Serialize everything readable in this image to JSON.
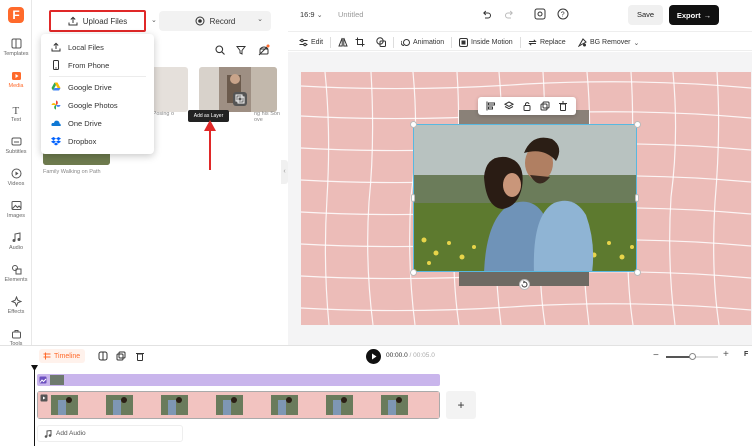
{
  "rail": {
    "items": [
      {
        "label": "Templates",
        "icon": "templates-icon"
      },
      {
        "label": "Media",
        "icon": "media-icon",
        "active": true
      },
      {
        "label": "Text",
        "icon": "text-icon"
      },
      {
        "label": "Subtitles",
        "icon": "subtitles-icon"
      },
      {
        "label": "Videos",
        "icon": "videos-icon"
      },
      {
        "label": "Images",
        "icon": "images-icon"
      },
      {
        "label": "Audio",
        "icon": "audio-icon"
      },
      {
        "label": "Elements",
        "icon": "elements-icon"
      },
      {
        "label": "Effects",
        "icon": "effects-icon"
      },
      {
        "label": "Tools",
        "icon": "tools-icon"
      }
    ]
  },
  "panel": {
    "upload_label": "Upload Files",
    "record_label": "Record",
    "media_captions": [
      "Family Walking on Path",
      "on Posing o",
      "ng his Son ove"
    ],
    "add_layer_tooltip": "Add as Layer"
  },
  "upload_menu": {
    "items": [
      {
        "label": "Local Files",
        "icon": "upload-icon"
      },
      {
        "label": "From Phone",
        "icon": "phone-icon"
      },
      {
        "label": "Google Drive",
        "icon": "google-drive-icon"
      },
      {
        "label": "Google Photos",
        "icon": "google-photos-icon"
      },
      {
        "label": "One Drive",
        "icon": "onedrive-icon"
      },
      {
        "label": "Dropbox",
        "icon": "dropbox-icon"
      }
    ]
  },
  "topbar": {
    "aspect": "16:9",
    "project_title": "Untitled",
    "save_label": "Save",
    "export_label": "Export"
  },
  "toolbar": {
    "edit": "Edit",
    "animation": "Animation",
    "inside_motion": "Inside Motion",
    "replace": "Replace",
    "bg_remover": "BG Remover"
  },
  "timeline": {
    "tab_label": "Timeline",
    "current_time": "00:00.0",
    "total_time": "00:05.0",
    "add_audio": "Add Audio",
    "add_track": "+",
    "fit_label": "F",
    "zoom_level": 0.5
  },
  "colors": {
    "accent": "#ff6a2b",
    "canvas_bg": "#ecbcb8",
    "selection": "#58b8e0",
    "track": "#c9b5ec",
    "highlight": "#e02828"
  }
}
